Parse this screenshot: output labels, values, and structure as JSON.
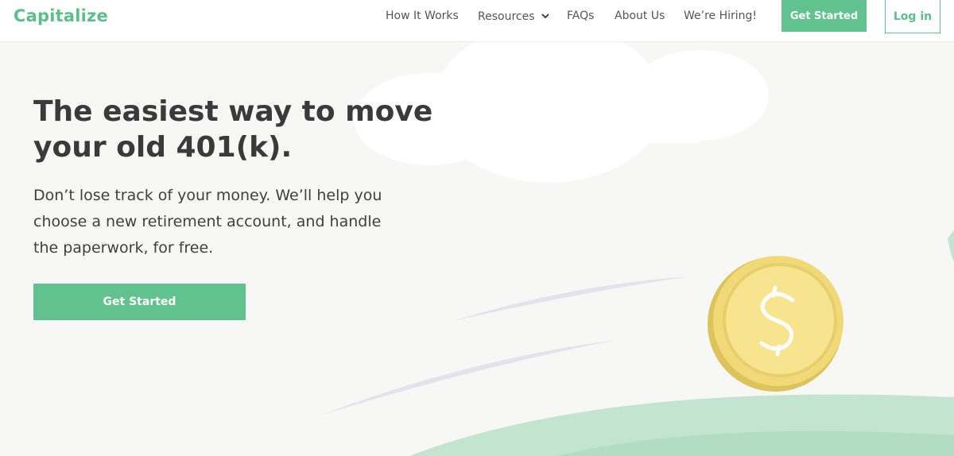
{
  "brand": {
    "name": "Capitalize",
    "color": "#5cbf8a"
  },
  "nav": {
    "items": [
      {
        "label": "How It Works"
      },
      {
        "label": "Resources",
        "icon": "chevron-down-icon"
      },
      {
        "label": "FAQs"
      },
      {
        "label": "About Us"
      },
      {
        "label": "We’re Hiring!"
      }
    ],
    "get_started_label": "Get Started",
    "login_label": "Log in"
  },
  "hero": {
    "title": "The easiest way to move your old 401(k).",
    "subtitle": "Don’t lose track of your money. We’ll help you choose a new retirement account, and handle the paperwork, for free.",
    "cta_label": "Get Started"
  },
  "illustration": {
    "elements": [
      "cloud",
      "coin-dollar-icon",
      "hill",
      "motion-streaks"
    ],
    "colors": {
      "coin": "#f8e38f",
      "coin_rim": "#e0c860",
      "hill": "#c3e5cf",
      "streak": "#e3e3ee"
    }
  },
  "colors": {
    "accent": "#62c28f",
    "background": "#f7f7f5",
    "text": "#3a3a3a"
  }
}
